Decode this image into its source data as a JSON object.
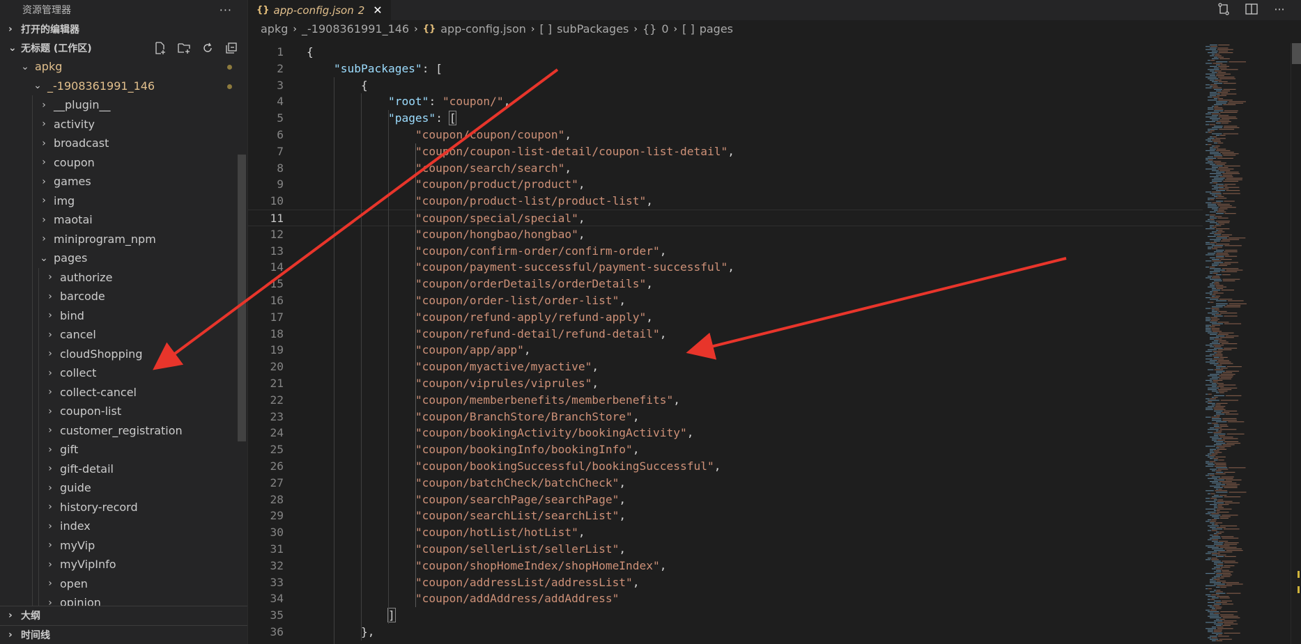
{
  "sidebar": {
    "title": "资源管理器",
    "more": "···",
    "open_editors": "打开的编辑器",
    "workspace": "无标题 (工作区)",
    "tree": [
      {
        "label": "apkg",
        "depth": 0,
        "expanded": true,
        "git": true,
        "dot": true
      },
      {
        "label": "_-1908361991_146",
        "depth": 1,
        "expanded": true,
        "git": true,
        "dot": true
      },
      {
        "label": "__plugin__",
        "depth": 2,
        "expanded": false
      },
      {
        "label": "activity",
        "depth": 2,
        "expanded": false
      },
      {
        "label": "broadcast",
        "depth": 2,
        "expanded": false
      },
      {
        "label": "coupon",
        "depth": 2,
        "expanded": false
      },
      {
        "label": "games",
        "depth": 2,
        "expanded": false
      },
      {
        "label": "img",
        "depth": 2,
        "expanded": false
      },
      {
        "label": "maotai",
        "depth": 2,
        "expanded": false
      },
      {
        "label": "miniprogram_npm",
        "depth": 2,
        "expanded": false
      },
      {
        "label": "pages",
        "depth": 2,
        "expanded": true
      },
      {
        "label": "authorize",
        "depth": 3,
        "expanded": false
      },
      {
        "label": "barcode",
        "depth": 3,
        "expanded": false
      },
      {
        "label": "bind",
        "depth": 3,
        "expanded": false
      },
      {
        "label": "cancel",
        "depth": 3,
        "expanded": false
      },
      {
        "label": "cloudShopping",
        "depth": 3,
        "expanded": false
      },
      {
        "label": "collect",
        "depth": 3,
        "expanded": false
      },
      {
        "label": "collect-cancel",
        "depth": 3,
        "expanded": false
      },
      {
        "label": "coupon-list",
        "depth": 3,
        "expanded": false
      },
      {
        "label": "customer_registration",
        "depth": 3,
        "expanded": false
      },
      {
        "label": "gift",
        "depth": 3,
        "expanded": false
      },
      {
        "label": "gift-detail",
        "depth": 3,
        "expanded": false
      },
      {
        "label": "guide",
        "depth": 3,
        "expanded": false
      },
      {
        "label": "history-record",
        "depth": 3,
        "expanded": false
      },
      {
        "label": "index",
        "depth": 3,
        "expanded": false
      },
      {
        "label": "myVip",
        "depth": 3,
        "expanded": false
      },
      {
        "label": "myVipInfo",
        "depth": 3,
        "expanded": false
      },
      {
        "label": "open",
        "depth": 3,
        "expanded": false
      },
      {
        "label": "opinion",
        "depth": 3,
        "expanded": false
      }
    ],
    "outline": "大纲",
    "timeline": "时间线"
  },
  "tab": {
    "label": "app-config.json",
    "badge": "2",
    "icon": "{}",
    "close": "✕"
  },
  "breadcrumb": {
    "items": [
      "apkg",
      "_-1908361991_146",
      "app-config.json",
      "subPackages",
      "0",
      "pages"
    ],
    "icons": [
      "",
      "",
      "{}",
      "[ ]",
      "{}",
      "[ ]"
    ]
  },
  "editor": {
    "current_line": 11,
    "pages": [
      "coupon/coupon/coupon",
      "coupon/coupon-list-detail/coupon-list-detail",
      "coupon/search/search",
      "coupon/product/product",
      "coupon/product-list/product-list",
      "coupon/special/special",
      "coupon/hongbao/hongbao",
      "coupon/confirm-order/confirm-order",
      "coupon/payment-successful/payment-successful",
      "coupon/orderDetails/orderDetails",
      "coupon/order-list/order-list",
      "coupon/refund-apply/refund-apply",
      "coupon/refund-detail/refund-detail",
      "coupon/app/app",
      "coupon/myactive/myactive",
      "coupon/viprules/viprules",
      "coupon/memberbenefits/memberbenefits",
      "coupon/BranchStore/BranchStore",
      "coupon/bookingActivity/bookingActivity",
      "coupon/bookingInfo/bookingInfo",
      "coupon/bookingSuccessful/bookingSuccessful",
      "coupon/batchCheck/batchCheck",
      "coupon/searchPage/searchPage",
      "coupon/searchList/searchList",
      "coupon/hotList/hotList",
      "coupon/sellerList/sellerList",
      "coupon/shopHomeIndex/shopHomeIndex",
      "coupon/addressList/addressList",
      "coupon/addAddress/addAddress"
    ],
    "key_subpackages": "\"subPackages\"",
    "key_root": "\"root\"",
    "val_root": "\"coupon/\"",
    "key_pages": "\"pages\""
  },
  "colors": {
    "accent_arrow": "#e8352b",
    "key": "#9cdcfe",
    "string": "#ce9178"
  }
}
